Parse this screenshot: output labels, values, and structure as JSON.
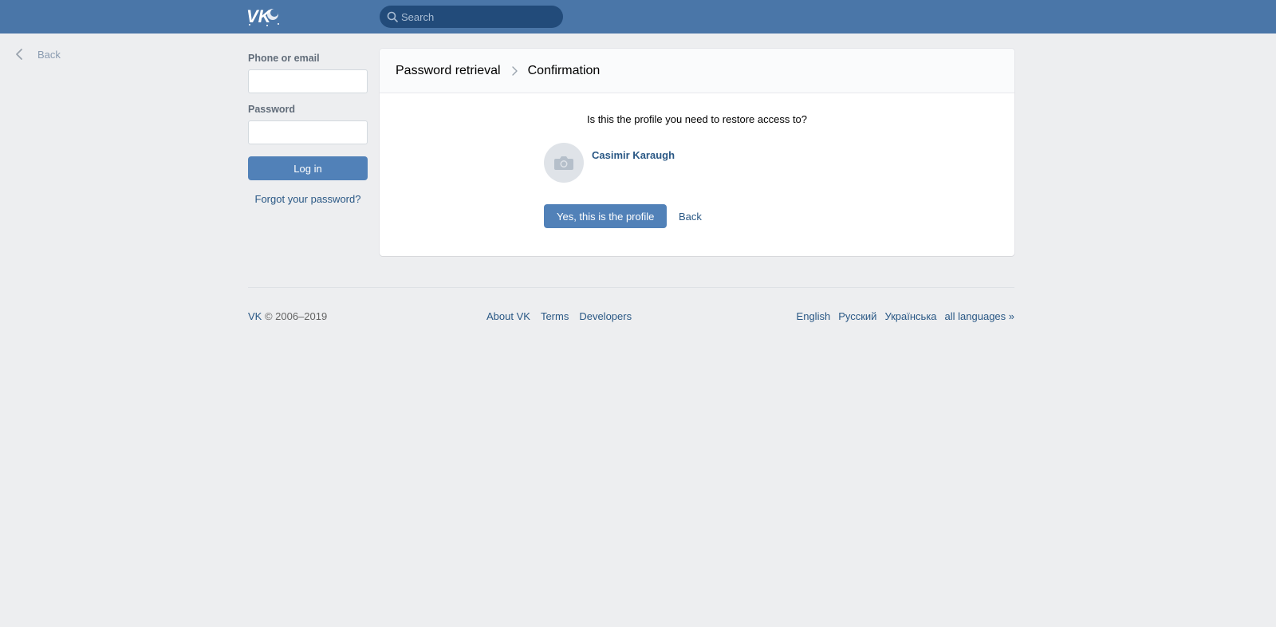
{
  "header": {
    "logo_text": "VK",
    "search_placeholder": "Search"
  },
  "nav": {
    "back_label": "Back"
  },
  "login": {
    "phone_label": "Phone or email",
    "password_label": "Password",
    "login_button": "Log in",
    "forgot_link": "Forgot your password?"
  },
  "card": {
    "breadcrumb": [
      "Password retrieval",
      "Confirmation"
    ],
    "question": "Is this the profile you need to restore access to?",
    "profile_name": "Casimir Karaugh",
    "confirm_button": "Yes, this is the profile",
    "back_link": "Back"
  },
  "footer": {
    "brand": "VK",
    "copyright": " © 2006–2019",
    "links": [
      "About VK",
      "Terms",
      "Developers"
    ],
    "languages": [
      "English",
      "Русский",
      "Українська",
      "all languages »"
    ]
  },
  "colors": {
    "header_bg": "#4a76a8",
    "search_bg": "#224b7a",
    "button_bg": "#5181b8",
    "link": "#2a5885",
    "page_bg": "#edeef0"
  }
}
